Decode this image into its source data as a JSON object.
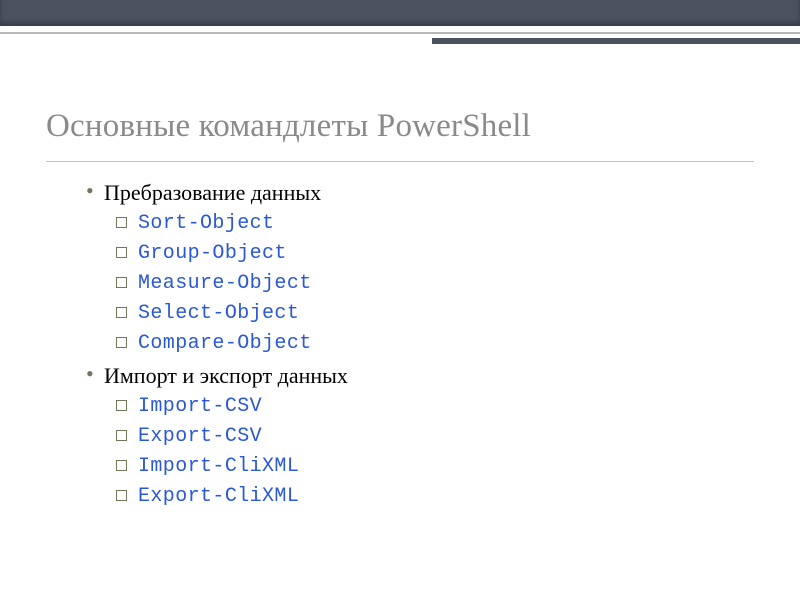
{
  "title": "Основные командлеты PowerShell",
  "sections": [
    {
      "heading": "Пребразование данных",
      "items": [
        "Sort-Object",
        "Group-Object",
        "Measure-Object",
        "Select-Object",
        "Compare-Object"
      ]
    },
    {
      "heading": "Импорт и экспорт данных",
      "items": [
        "Import-CSV",
        "Export-CSV",
        "Import-CliXML",
        "Export-CliXML"
      ]
    }
  ]
}
